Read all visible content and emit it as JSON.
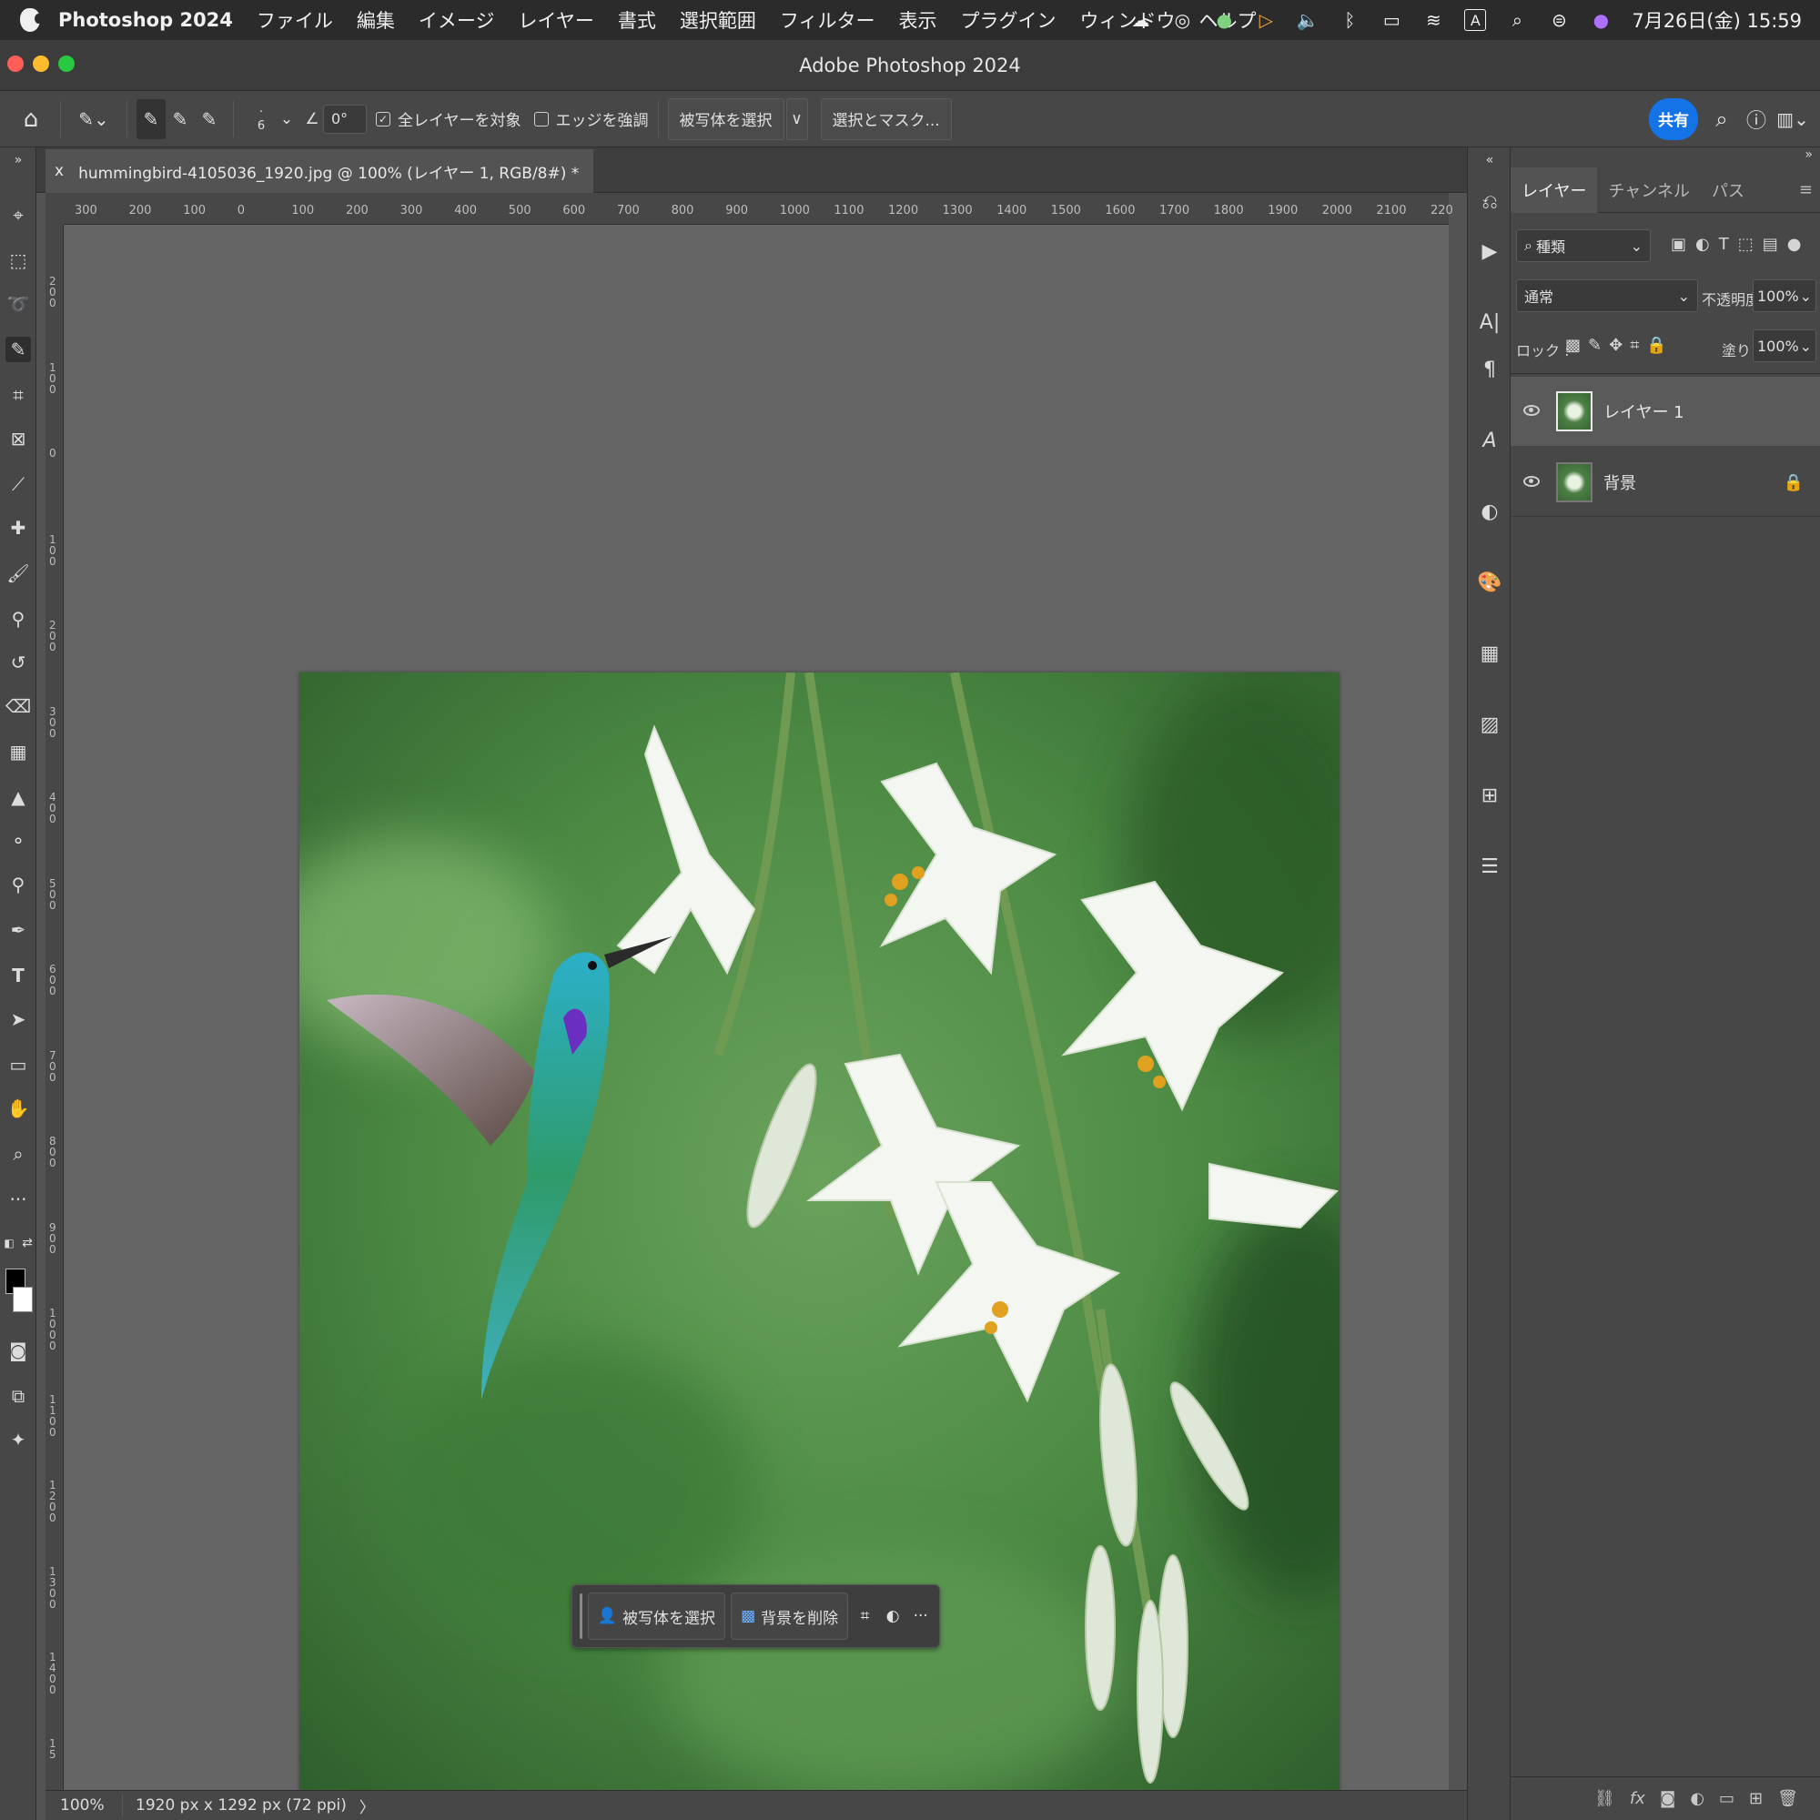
{
  "menubar": {
    "app_name": "Photoshop 2024",
    "items": [
      "ファイル",
      "編集",
      "イメージ",
      "レイヤー",
      "書式",
      "選択範囲",
      "フィルター",
      "表示",
      "プラグイン",
      "ウィンドウ",
      "ヘルプ"
    ],
    "clock": "7月26日(金) 15:59",
    "input_mode": "A"
  },
  "window": {
    "title": "Adobe Photoshop 2024"
  },
  "options_bar": {
    "brush_size": "6",
    "angle": "0°",
    "sample_all_layers": "全レイヤーを対象",
    "enhance_edge": "エッジを強調",
    "select_subject": "被写体を選択",
    "select_and_mask": "選択とマスク...",
    "share": "共有"
  },
  "document": {
    "tab_title": "hummingbird-4105036_1920.jpg @ 100% (レイヤー 1, RGB/8#) *",
    "close": "x"
  },
  "ruler": {
    "h_ticks": [
      "300",
      "200",
      "100",
      "0",
      "100",
      "200",
      "300",
      "400",
      "500",
      "600",
      "700",
      "800",
      "900",
      "1000",
      "1100",
      "1200",
      "1300",
      "1400",
      "1500",
      "1600",
      "1700",
      "1800",
      "1900",
      "2000",
      "2100",
      "220"
    ],
    "v_ticks": [
      "2\n0\n0",
      "1\n0\n0",
      "0",
      "1\n0\n0",
      "2\n0\n0",
      "3\n0\n0",
      "4\n0\n0",
      "5\n0\n0",
      "6\n0\n0",
      "7\n0\n0",
      "8\n0\n0",
      "9\n0\n0",
      "1\n0\n0\n0",
      "1\n1\n0\n0",
      "1\n2\n0\n0",
      "1\n3\n0\n0",
      "1\n4\n0\n0",
      "1\n5"
    ]
  },
  "context_bar": {
    "select_subject": "被写体を選択",
    "remove_bg": "背景を削除",
    "more": "···"
  },
  "statusbar": {
    "zoom": "100%",
    "doc_info": "1920 px x 1292 px (72 ppi)",
    "arrow": "〉"
  },
  "layers_panel": {
    "tabs": [
      "レイヤー",
      "チャンネル",
      "パス"
    ],
    "filter_kind": "種類",
    "blend_mode": "通常",
    "opacity_label": "不透明度 :",
    "opacity_value": "100%",
    "lock_label": "ロック :",
    "fill_label": "塗り :",
    "fill_value": "100%",
    "layers": [
      {
        "name": "レイヤー 1",
        "selected": true
      },
      {
        "name": "背景",
        "locked": true
      }
    ]
  },
  "colors": {
    "accent": "#1473e6",
    "panel": "#474747",
    "canvas": "#656565",
    "menubar": "#2b2b2b"
  }
}
